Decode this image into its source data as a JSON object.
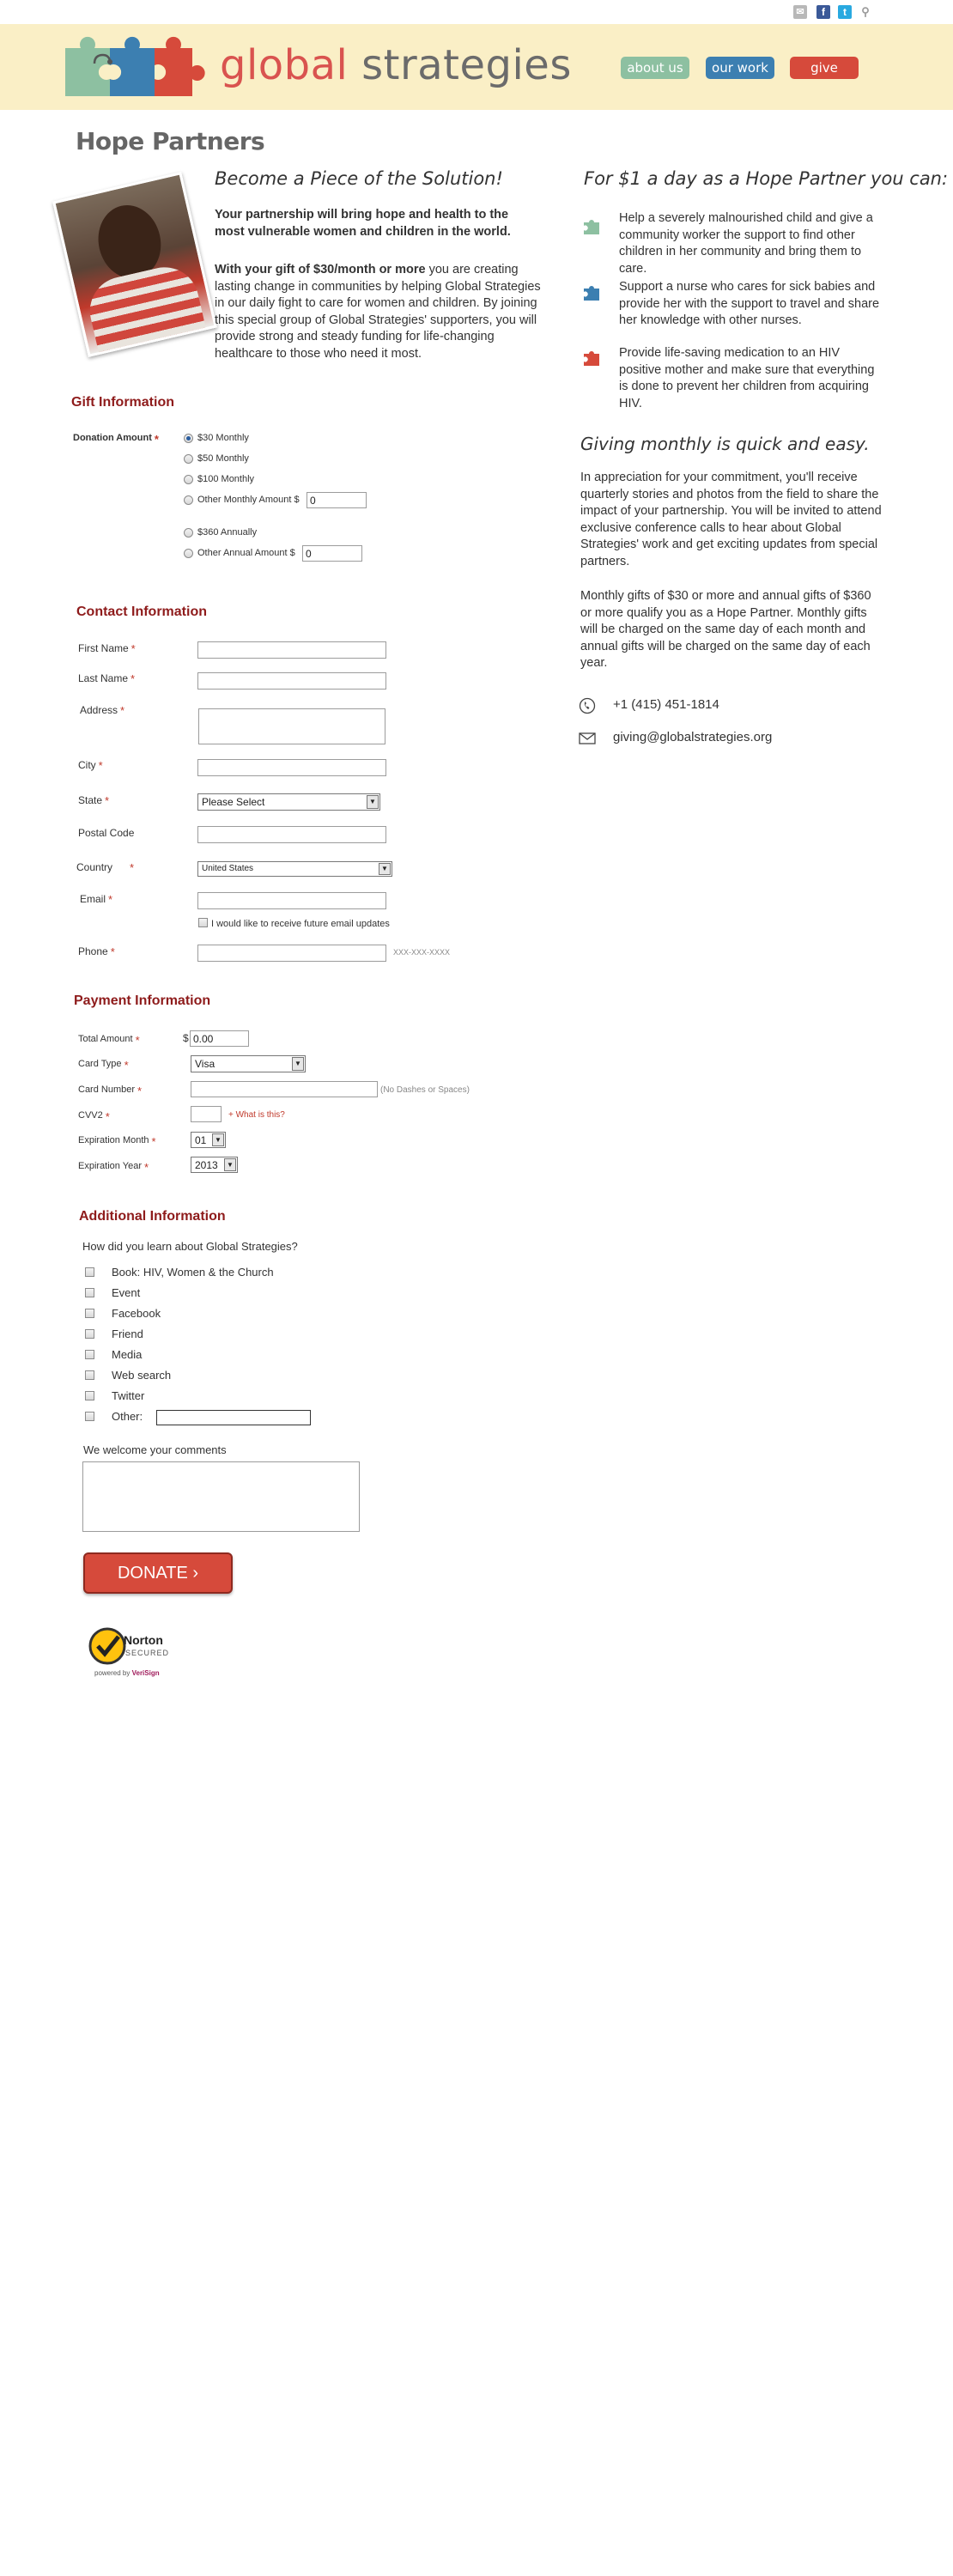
{
  "topbar": {
    "icons": [
      "mail-icon",
      "facebook-icon",
      "twitter-icon",
      "search-icon"
    ]
  },
  "header": {
    "logo_part1": "global",
    "logo_part2": " strategies",
    "nav": [
      {
        "label": "about us",
        "color": "#8dc0a1"
      },
      {
        "label": "our work",
        "color": "#3c7fb1"
      },
      {
        "label": "give",
        "color": "#d64a3b"
      }
    ]
  },
  "page_title": "Hope Partners",
  "intro": {
    "heading": "Become a Piece of the Solution!",
    "bold": "Your partnership will bring hope and health to the most vulnerable women and children in the world.",
    "para_bold": "With your gift of $30/month or more",
    "para_rest": " you are creating lasting change in communities by helping Global Strategies in our daily fight to care for women and children. By joining this special group of Global Strategies' supporters, you will provide strong and steady funding for life-changing healthcare to those who need it most."
  },
  "gift": {
    "title": "Gift Information",
    "donation_label": "Donation Amount",
    "options": [
      "$30 Monthly",
      "$50 Monthly",
      "$100 Monthly",
      "Other Monthly Amount $",
      "$360 Annually",
      "Other Annual Amount $"
    ],
    "selected": "$30 Monthly",
    "other_monthly_value": "0",
    "other_annual_value": "0"
  },
  "contact_info": {
    "title": "Contact Information",
    "first_name": "First Name",
    "last_name": "Last Name",
    "address": "Address",
    "city": "City",
    "state": "State",
    "state_value": "Please Select",
    "postal": "Postal Code",
    "country": "Country",
    "country_value": "United States",
    "email": "Email",
    "email_updates": "I would like to receive future email updates",
    "phone": "Phone",
    "phone_hint": "XXX-XXX-XXXX"
  },
  "payment": {
    "title": "Payment Information",
    "total_amount": "Total Amount",
    "currency": "$",
    "total_value": "0.00",
    "card_type": "Card Type",
    "card_type_value": "Visa",
    "card_number": "Card Number",
    "card_hint": "(No Dashes or Spaces)",
    "cvv2": "CVV2",
    "cvv_link": "+ What is this?",
    "exp_month": "Expiration Month",
    "exp_month_value": "01",
    "exp_year": "Expiration Year",
    "exp_year_value": "2013"
  },
  "additional": {
    "title": "Additional Information",
    "question": "How did you learn about Global Strategies?",
    "sources": [
      "Book: HIV, Women & the Church",
      "Event",
      "Facebook",
      "Friend",
      "Media",
      "Web search",
      "Twitter",
      "Other:"
    ],
    "comments_label": "We welcome your comments"
  },
  "donate_button": "DONATE ›",
  "norton": {
    "brand": "Norton",
    "secured": "SECURED",
    "powered": "powered by",
    "verisign": "VeriSign"
  },
  "right": {
    "heading": "For $1 a day as a Hope Partner you can:",
    "bullets": [
      {
        "text": "Help a severely malnourished child and give a community worker the support to find other children in her community and bring them to care.",
        "color": "#8dc0a1"
      },
      {
        "text": "Support a nurse who cares for sick babies and provide her with the support to travel and share her knowledge with other nurses.",
        "color": "#3c7fb1"
      },
      {
        "text": "Provide life-saving medication to an HIV positive mother and make sure that everything is done to prevent her children from acquiring HIV.",
        "color": "#d64a3b"
      }
    ],
    "heading2": "Giving monthly is quick and easy.",
    "para1": "In appreciation for your commitment, you'll receive quarterly stories and photos from the field to share the impact of your partnership. You will be invited to attend exclusive conference calls to hear about Global Strategies' work and get exciting updates from special partners.",
    "para2": "Monthly gifts of $30 or more and annual gifts of $360 or more qualify you as a Hope Partner. Monthly gifts will be charged on the same day of each month and annual gifts will be charged on the same day of each year.",
    "phone": "+1 (415) 451-1814",
    "email": "giving@globalstrategies.org"
  }
}
